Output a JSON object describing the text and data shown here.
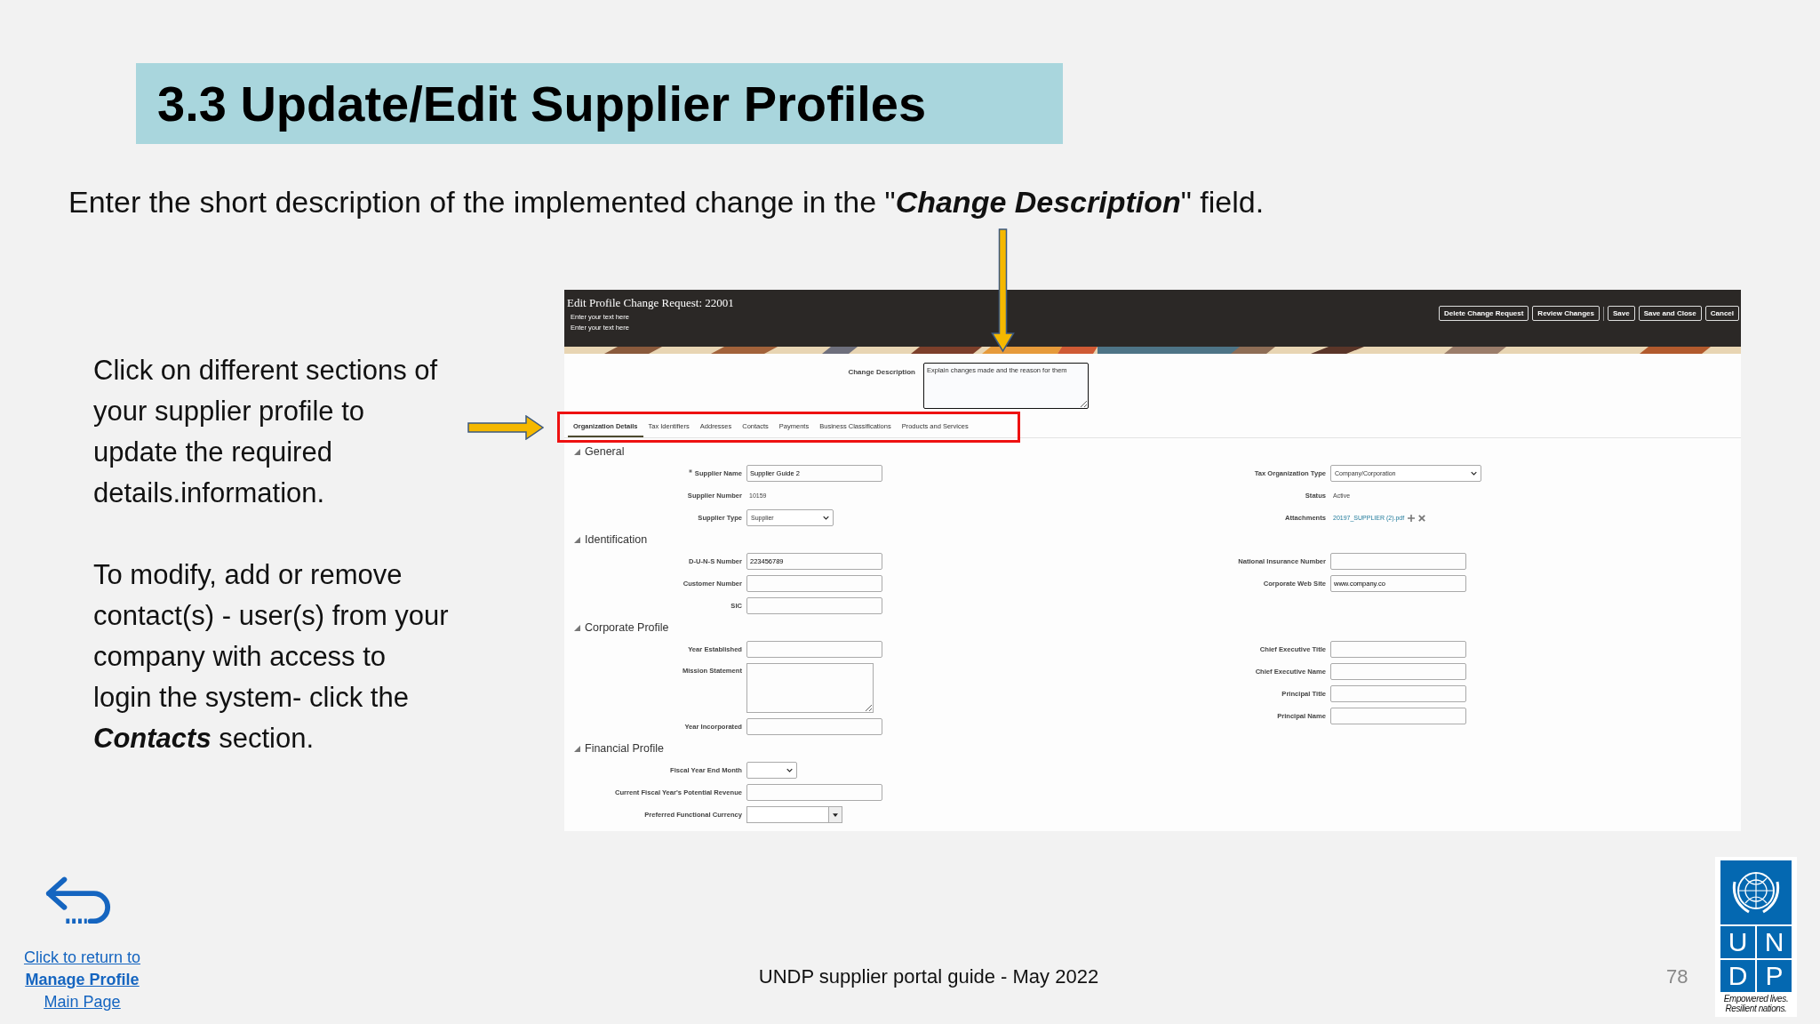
{
  "slide": {
    "title": "3.3 Update/Edit Supplier Profiles",
    "instruction": "Enter the short description of the implemented change in the \"**Change Description**\" field.",
    "notes": [
      "Click on different sections of your supplier profile to update the required details.information.",
      "To modify, add or remove contact(s) - user(s) from your company with access to login the system- click the **Contacts** section."
    ]
  },
  "app": {
    "title": "Edit Profile Change Request: 22001",
    "subtitles": [
      "Enter your text here",
      "Enter your text here"
    ],
    "buttons": [
      {
        "label": "Delete Change Request"
      },
      {
        "label": "Review Changes"
      },
      {
        "label": "Save"
      },
      {
        "label": "Save and Close"
      },
      {
        "label": "Cancel"
      }
    ],
    "change_description": {
      "label": "Change Description",
      "placeholder": "Explain changes made and the reason for them"
    },
    "tabs": [
      {
        "label": "Organization Details",
        "selected": true
      },
      {
        "label": "Tax Identifiers",
        "selected": false
      },
      {
        "label": "Addresses",
        "selected": false
      },
      {
        "label": "Contacts",
        "selected": false
      },
      {
        "label": "Payments",
        "selected": false
      },
      {
        "label": "Business Classifications",
        "selected": false
      },
      {
        "label": "Products and Services",
        "selected": false
      }
    ],
    "sections": [
      {
        "title": "General",
        "left": [
          {
            "label": "Supplier Name",
            "kind": "input",
            "value": "Supplier Guide 2",
            "required": true
          },
          {
            "label": "Supplier Number",
            "kind": "text",
            "value": "10159",
            "required": false
          },
          {
            "label": "Supplier Type",
            "kind": "select",
            "value": "Supplier",
            "required": false
          }
        ],
        "right": [
          {
            "label": "Tax Organization Type",
            "kind": "wideselect",
            "value": "Company/Corporation",
            "required": false
          },
          {
            "label": "Status",
            "kind": "text",
            "value": "Active",
            "required": false
          },
          {
            "label": "Attachments",
            "kind": "link",
            "value": "20197_SUPPLIER (2).pdf",
            "required": false
          }
        ]
      },
      {
        "title": "Identification",
        "left": [
          {
            "label": "D-U-N-S Number",
            "kind": "input",
            "value": "223456789",
            "required": false
          },
          {
            "label": "Customer Number",
            "kind": "input",
            "required": false
          },
          {
            "label": "SIC",
            "kind": "input",
            "required": false
          }
        ],
        "right": [
          {
            "label": "National Insurance Number",
            "kind": "input",
            "required": false
          },
          {
            "label": "Corporate Web Site",
            "kind": "input",
            "value": "www.company.co",
            "required": false
          }
        ]
      },
      {
        "title": "Corporate Profile",
        "left": [
          {
            "label": "Year Established",
            "kind": "input",
            "required": false
          },
          {
            "label": "Mission Statement",
            "kind": "textarea",
            "required": false
          },
          {
            "label": "Year Incorporated",
            "kind": "input",
            "required": false
          }
        ],
        "right": [
          {
            "label": "Chief Executive Title",
            "kind": "input",
            "required": false
          },
          {
            "label": "Chief Executive Name",
            "kind": "input",
            "required": false
          },
          {
            "label": "Principal Title",
            "kind": "input",
            "required": false
          },
          {
            "label": "Principal Name",
            "kind": "input",
            "required": false
          }
        ]
      },
      {
        "title": "Financial Profile",
        "left": [
          {
            "label": "Fiscal Year End Month",
            "kind": "smallselect",
            "required": false
          },
          {
            "label": "Current Fiscal Year's Potential Revenue",
            "kind": "input",
            "required": false
          },
          {
            "label": "Preferred Functional Currency",
            "kind": "combo",
            "required": false
          }
        ]
      }
    ]
  },
  "footer": {
    "return_link": [
      "Click to return to",
      "**Manage Profile**",
      "Main Page"
    ],
    "text": "UNDP supplier portal guide - May 2022",
    "page": "78",
    "logo": {
      "letters": [
        "U",
        "N",
        "D",
        "P"
      ],
      "tagline": [
        "Empowered lives.",
        "Resilient nations."
      ]
    }
  }
}
